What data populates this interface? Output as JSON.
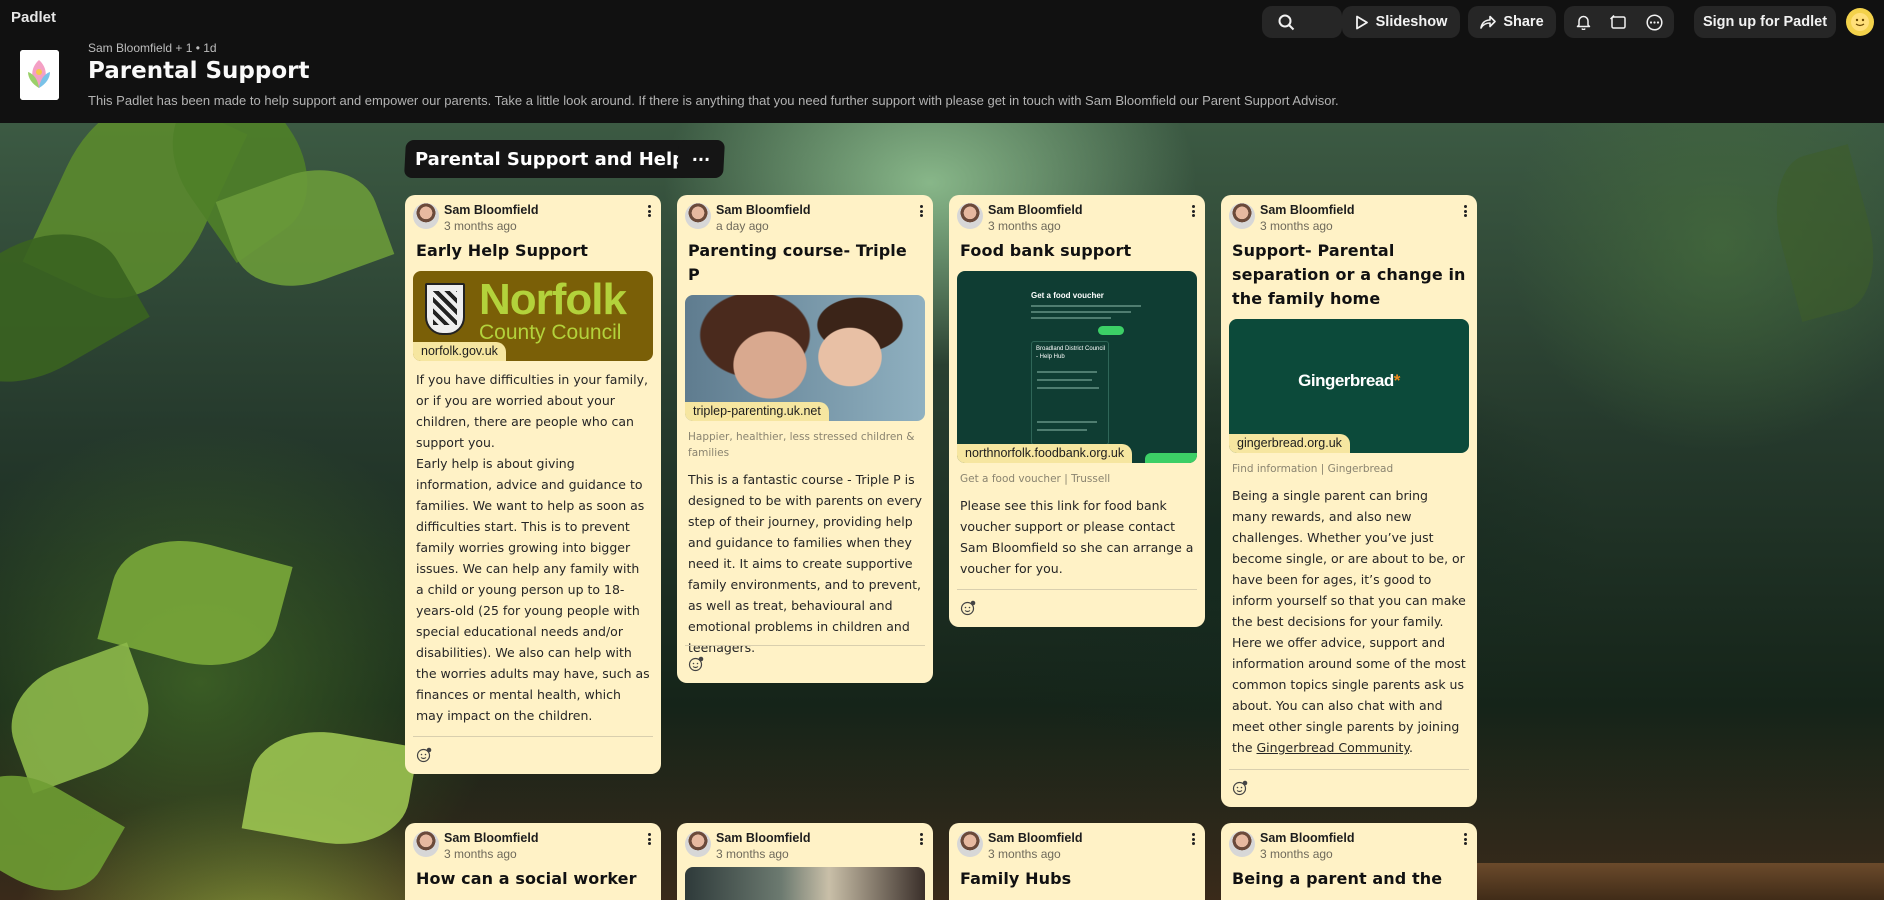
{
  "app": {
    "brand": "Padlet"
  },
  "toolbar": {
    "slideshow_label": "Slideshow",
    "share_label": "Share",
    "signup_label": "Sign up for Padlet"
  },
  "header": {
    "meta": "Sam Bloomfield + 1 • 1d",
    "title": "Parental Support",
    "description": "This Padlet has been made to help support and empower our parents. Take a little look around. If there is anything that you need further support with please get in touch with Sam Bloomfield our Parent Support Advisor."
  },
  "section": {
    "title": "Parental Support and Help",
    "more_label": "···"
  },
  "cards": [
    {
      "author": "Sam Bloomfield",
      "time": "3 months ago",
      "title": "Early Help Support",
      "media_logo_big": "Norfolk",
      "media_logo_small": "County Council",
      "host": "norfolk.gov.uk",
      "caption": "",
      "body": "If you have difficulties in your family, or if you are worried about your children, there are people who can support you.\nEarly help is about giving information, advice and guidance to families. We want to help as soon as difficulties start. This is to prevent family worries growing into bigger issues. We can help any family with a child or young person up to 18-years-old (25 for young people with special educational needs and/or disabilities). We also can help with the worries adults may have, such as finances or mental health, which may impact on the children."
    },
    {
      "author": "Sam Bloomfield",
      "time": "a day ago",
      "title": "Parenting course- Triple P",
      "host": "triplep-parenting.uk.net",
      "caption": "Happier, healthier, less stressed children & families",
      "body": "This is a fantastic course - Triple P is designed to be with parents on every step of their journey, providing help and guidance to families when they need it. It aims to create supportive family environments, and to prevent, as well as treat, behavioural and emotional problems in children and teenagers."
    },
    {
      "author": "Sam Bloomfield",
      "time": "3 months ago",
      "title": "Food bank support",
      "host": "northnorfolk.foodbank.org.uk",
      "caption": "Get a food voucher | Trussell",
      "media_heading": "Get a food voucher",
      "media_box_text": "Broadland District Council - Help Hub",
      "body": "Please see this link for food bank voucher support or please contact Sam Bloomfield so she can arrange a voucher for you."
    },
    {
      "author": "Sam Bloomfield",
      "time": "3 months ago",
      "title": "Support- Parental separation or a change in the family home",
      "media_logo": "Gingerbread",
      "host": "gingerbread.org.uk",
      "caption": "Find information | Gingerbread",
      "body_part1": "Being a single parent can bring many rewards, and also new challenges. Whether you’ve just become single, or are about to be, or have been for ages, it’s good to inform yourself so that you can make the best decisions for your family.\nHere we offer advice, support and information around some of the most common topics single parents ask us about. You can also chat with and meet other single parents  by joining the ",
      "body_link": "Gingerbread Community",
      "body_part2": "."
    }
  ],
  "row2": [
    {
      "author": "Sam Bloomfield",
      "time": "3 months ago",
      "title": "How can a social worker"
    },
    {
      "author": "Sam Bloomfield",
      "time": "3 months ago",
      "title": ""
    },
    {
      "author": "Sam Bloomfield",
      "time": "3 months ago",
      "title": "Family Hubs"
    },
    {
      "author": "Sam Bloomfield",
      "time": "3 months ago",
      "title": "Being a parent and the"
    }
  ],
  "colors": {
    "card_bg": "#fff2c6",
    "topbar_bg": "#111111",
    "host_tag": "#f6e6a0"
  }
}
